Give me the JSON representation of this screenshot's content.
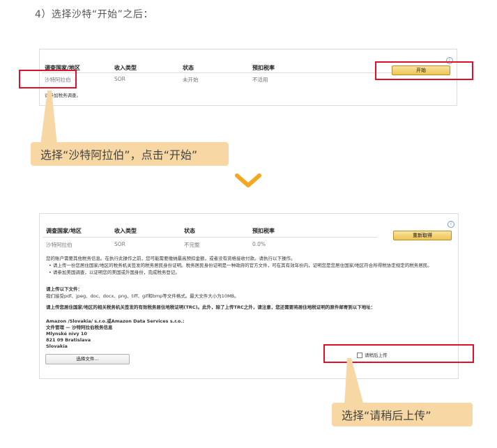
{
  "step_heading": "4）选择沙特“开始”之后：",
  "panel1": {
    "headers": [
      "调查国家/地区",
      "收入类型",
      "状态",
      "预扣税率"
    ],
    "row": [
      "沙特阿拉伯",
      "SOR",
      "未开始",
      "不适用"
    ],
    "note": "请参加税务调查。",
    "start_button": "开始",
    "info": "i"
  },
  "callout1": "选择“沙特阿拉伯”，点击“开始”",
  "panel2": {
    "headers": [
      "调查国家/地区",
      "收入类型",
      "状态",
      "预扣税率"
    ],
    "row": [
      "沙特阿拉伯",
      "SOR",
      "不完整",
      "0.0%"
    ],
    "retake_button": "重新取得",
    "info": "i",
    "intro": "您的账户需要其他税务信息。在执行此操作之前，您可能需要缴纳最高预扣金额，或者没有资格接收付款。请执行以下操作。",
    "bullets": [
      "请上传一份您居住国家/地区的税务机关签发的税务居民身份证明。税务居民身份证明是一种政府的官方文件，可在其有效年份内，证明您是您居住国家/地区符合所得税协定规定的税务居民。",
      "请参加美国调查，以证明您的美国或外国身份，完成税务登记。"
    ],
    "upload_title": "请上传以下文件：",
    "upload_formats": "我们接受pdf、jpeg、doc、docx、png、tiff、gif和bmp等文件格式。最大文件大小为10MB。",
    "mail_instruction": "请上传您居住国家/地区的相关税务机关签发的有效税务居住地税证明(TRC)。此外，除了上传TRC之外，请注意，您还需要将居住地税证明的原件邮寄到以下地址：",
    "address": [
      "Amazon /Slovakia/ s.r.o.或Amazon Data Services s.r.o.:",
      "文件管理 — 沙特阿拉伯税务信息",
      "Mlynské nivy 10",
      "821 09 Bratislava",
      "Slovakia"
    ],
    "choose_file_button": "选择文件...",
    "upload_later_label": "请稍后上传"
  },
  "callout2": "选择“请稍后上传”"
}
